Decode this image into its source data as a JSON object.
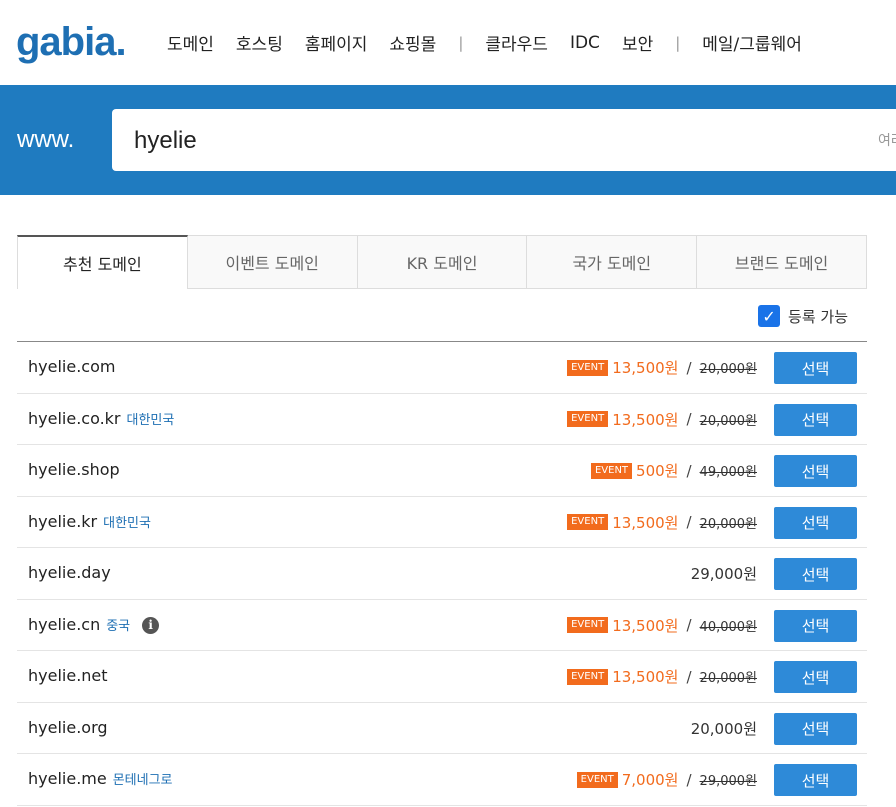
{
  "header": {
    "logo": "gabia.",
    "nav": [
      "도메인",
      "호스팅",
      "홈페이지",
      "쇼핑몰",
      "클라우드",
      "IDC",
      "보안",
      "메일/그룹웨어"
    ]
  },
  "search": {
    "prefix": "www.",
    "value": "hyelie",
    "hint": "여러"
  },
  "tabs": [
    "추천 도메인",
    "이벤트 도메인",
    "KR 도메인",
    "국가 도메인",
    "브랜드 도메인"
  ],
  "filter": {
    "label": "등록 가능",
    "checked": true
  },
  "event_label": "EVENT",
  "select_label": "선택",
  "domains": [
    {
      "name": "hyelie.com",
      "country": "",
      "event": true,
      "price": "13,500원",
      "original": "20,000원",
      "info": false
    },
    {
      "name": "hyelie.co.kr",
      "country": "대한민국",
      "event": true,
      "price": "13,500원",
      "original": "20,000원",
      "info": false
    },
    {
      "name": "hyelie.shop",
      "country": "",
      "event": true,
      "price": "500원",
      "original": "49,000원",
      "info": false
    },
    {
      "name": "hyelie.kr",
      "country": "대한민국",
      "event": true,
      "price": "13,500원",
      "original": "20,000원",
      "info": false
    },
    {
      "name": "hyelie.day",
      "country": "",
      "event": false,
      "price": "29,000원",
      "original": "",
      "info": false
    },
    {
      "name": "hyelie.cn",
      "country": "중국",
      "event": true,
      "price": "13,500원",
      "original": "40,000원",
      "info": true
    },
    {
      "name": "hyelie.net",
      "country": "",
      "event": true,
      "price": "13,500원",
      "original": "20,000원",
      "info": false
    },
    {
      "name": "hyelie.org",
      "country": "",
      "event": false,
      "price": "20,000원",
      "original": "",
      "info": false
    },
    {
      "name": "hyelie.me",
      "country": "몬테네그로",
      "event": true,
      "price": "7,000원",
      "original": "29,000원",
      "info": false
    }
  ],
  "colors": {
    "brand": "#1f7bc0",
    "event": "#f26b1d",
    "button": "#2e8ad8"
  }
}
